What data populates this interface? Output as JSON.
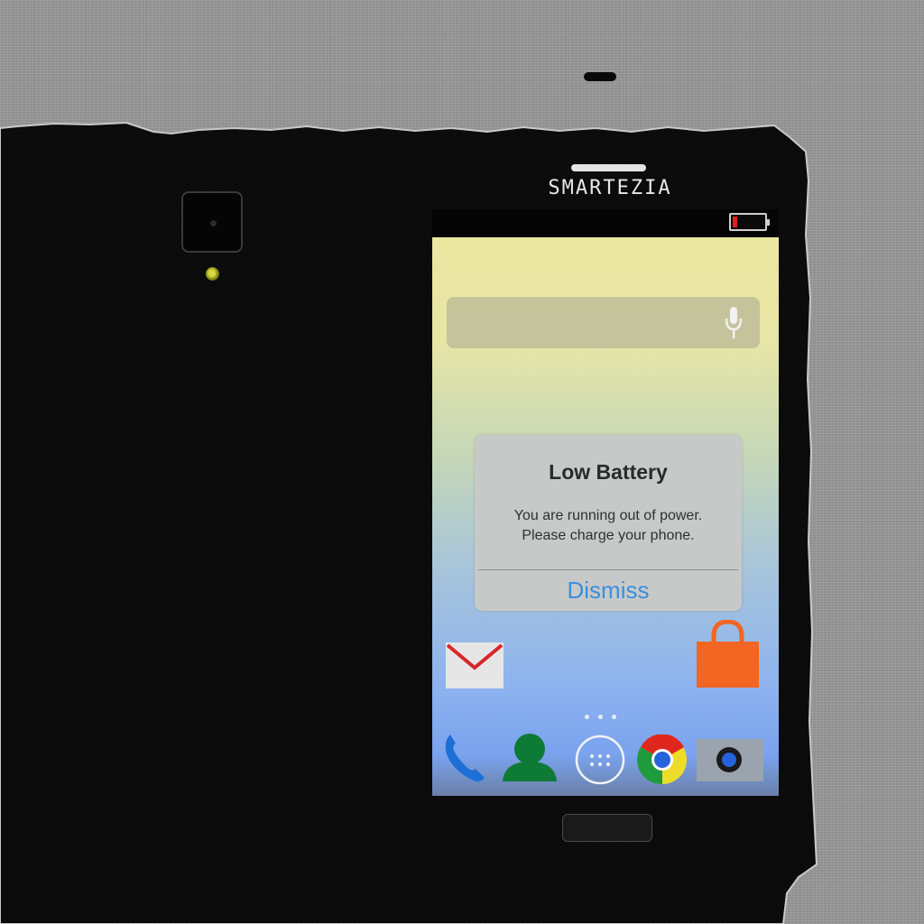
{
  "phone": {
    "brand": "SMARTEZIA"
  },
  "status_bar": {
    "battery_level": 0.15,
    "battery_color": "#e02020"
  },
  "search_bar": {
    "icon": "microphone-icon"
  },
  "dialog": {
    "title": "Low Battery",
    "message_line1": "You are running out of power.",
    "message_line2": "Please charge your phone.",
    "button_label": "Dismiss",
    "button_color": "#3b8fde"
  },
  "home_apps": [
    {
      "icon": "gmail-icon"
    },
    {
      "icon": "shopping-bag-icon"
    }
  ],
  "page_indicator": {
    "pages": 3
  },
  "dock": [
    {
      "icon": "phone-icon"
    },
    {
      "icon": "contacts-icon"
    },
    {
      "icon": "app-drawer-icon"
    },
    {
      "icon": "chrome-icon"
    },
    {
      "icon": "camera-icon"
    }
  ]
}
